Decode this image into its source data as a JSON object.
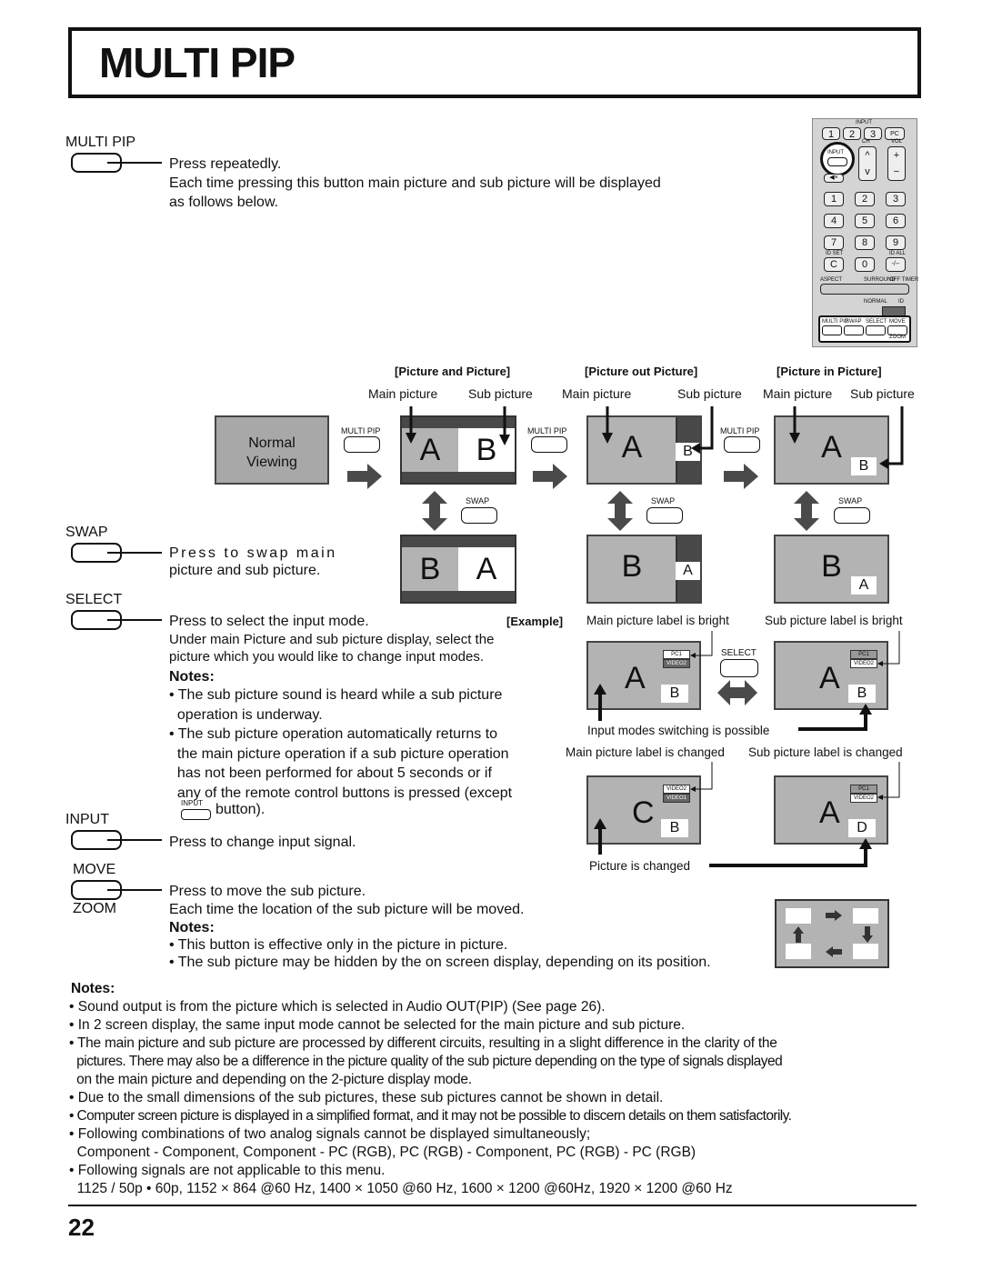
{
  "page": {
    "title": "MULTI PIP",
    "page_number": "22"
  },
  "remote": {
    "input_group_label": "INPUT",
    "input_keys": [
      "1",
      "2",
      "3",
      "PC"
    ],
    "input_button": "INPUT",
    "ch_label": "CH",
    "vol_label": "VOL",
    "ch_up": "^",
    "ch_down": "v",
    "vol_up": "+",
    "vol_down": "−",
    "mute_icon": "mute-icon",
    "number_keys": [
      "1",
      "2",
      "3",
      "4",
      "5",
      "6",
      "7",
      "8",
      "9",
      "C",
      "0",
      "-/--"
    ],
    "id_set": "ID SET",
    "id_all": "ID ALL",
    "aspect": "ASPECT",
    "surround": "SURROUND",
    "off_timer": "OFF TIMER",
    "normal": "NORMAL",
    "id": "ID",
    "bottom_buttons": [
      "MULTI PIP",
      "SWAP",
      "SELECT",
      "MOVE"
    ],
    "zoom": "ZOOM"
  },
  "sections": {
    "multipip": {
      "label": "MULTI PIP",
      "line1": "Press repeatedly.",
      "line2": "Each time pressing this button main picture and sub picture will be displayed",
      "line3": "as follows below."
    },
    "swap": {
      "label": "SWAP",
      "line1": "Press to swap main",
      "line2": "picture and sub picture."
    },
    "select": {
      "label": "SELECT",
      "line1": "Press to select the input mode.",
      "line2": "Under main Picture and sub picture display, select the",
      "line3": "picture which you would like to change input modes.",
      "notes_title": "Notes:",
      "notes": [
        [
          "The sub picture sound is heard while a sub picture",
          "operation is underway."
        ],
        [
          "The sub picture operation automatically returns to",
          "the main picture operation if a sub picture operation",
          "has not been performed for about 5 seconds or if",
          "any of the remote control buttons is pressed (except"
        ]
      ],
      "inline_button_label": "INPUT",
      "after_button": "button)."
    },
    "input": {
      "label": "INPUT",
      "line1": "Press to change input signal."
    },
    "move": {
      "label": "MOVE",
      "sublabel": "ZOOM",
      "line1": "Press to move the sub picture.",
      "line2": "Each time the location of the sub picture will be moved.",
      "notes_title": "Notes:",
      "notes": [
        "This button is effective only in the picture in picture.",
        "The sub picture may be hidden by the on screen display, depending on its position."
      ]
    }
  },
  "diagram": {
    "normal_viewing": [
      "Normal",
      "Viewing"
    ],
    "multipip_btn": "MULTI PIP",
    "swap_btn": "SWAP",
    "modes": [
      {
        "title": "[Picture and Picture]",
        "main": "Main picture",
        "sub": "Sub picture",
        "top": [
          "A",
          "B"
        ],
        "bottom": [
          "B",
          "A"
        ]
      },
      {
        "title": "[Picture out Picture]",
        "main": "Main picture",
        "sub": "Sub picture",
        "top": [
          "A",
          "B"
        ],
        "bottom": [
          "B",
          "A"
        ]
      },
      {
        "title": "[Picture in Picture]",
        "main": "Main picture",
        "sub": "Sub picture",
        "top": [
          "A",
          "B"
        ],
        "bottom": [
          "B",
          "A"
        ]
      }
    ]
  },
  "example": {
    "label": "[Example]",
    "left_caption": "Main picture label is bright",
    "right_caption": "Sub picture label is bright",
    "select_btn": "SELECT",
    "switch_caption": "Input modes switching is possible",
    "left_changed_caption": "Main picture label is changed",
    "right_changed_caption": "Sub picture label is changed",
    "picture_changed": "Picture is changed",
    "row1_left": {
      "main": "A",
      "sub": "B",
      "osd": [
        "PC1",
        "VIDEO2"
      ]
    },
    "row1_right": {
      "main": "A",
      "sub": "B",
      "osd": [
        "PC1",
        "VIDEO2"
      ]
    },
    "row2_left": {
      "main": "C",
      "sub": "B",
      "osd": [
        "VIDEO2",
        "VIDEO1"
      ]
    },
    "row2_right": {
      "main": "A",
      "sub": "D",
      "osd": [
        "PC1",
        "VIDEO2"
      ]
    }
  },
  "notes": {
    "title": "Notes:",
    "items": [
      [
        "Sound output is from the picture which is selected in Audio OUT(PIP) (See page 26)."
      ],
      [
        "In 2 screen display, the same input mode cannot be selected for the main picture and sub picture."
      ],
      [
        "The main picture and sub picture are processed by different circuits, resulting in a slight difference in the clarity of the",
        "pictures. There may also be a difference in the picture quality of the sub picture depending on the type of signals displayed",
        "on the main picture and depending on the 2-picture display mode."
      ],
      [
        "Due to the small dimensions of the sub pictures, these sub pictures cannot be shown in detail."
      ],
      [
        "Computer screen picture is displayed in a simplified format, and it may not be possible to discern details on them satisfactorily."
      ],
      [
        "Following combinations of two analog signals cannot be displayed simultaneously;",
        "Component - Component, Component - PC (RGB), PC (RGB) - Component, PC (RGB) - PC (RGB)"
      ],
      [
        "Following signals are not applicable to this menu.",
        "1125 / 50p • 60p, 1152 × 864 @60 Hz, 1400 × 1050 @60 Hz, 1600 × 1200 @60Hz, 1920 × 1200 @60 Hz"
      ]
    ]
  }
}
